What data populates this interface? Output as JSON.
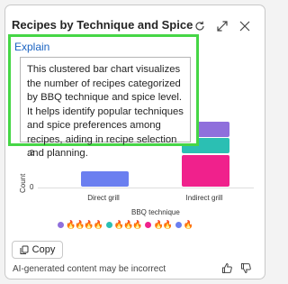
{
  "card": {
    "title": "Recipes by Technique and Spice",
    "refresh_icon": "refresh-icon",
    "expand_icon": "expand-icon",
    "close_icon": "close-icon"
  },
  "explain": {
    "link": "Explain",
    "text": "This clustered bar chart visualizes the number of recipes categorized by BBQ technique and spice level. It helps identify popular techniques and spice preferences among recipes, aiding in recipe selection and planning."
  },
  "chart_data": {
    "type": "bar",
    "stacked": true,
    "categories": [
      "Direct grill",
      "Indirect grill"
    ],
    "xlabel": "BBQ technique",
    "ylabel": "Count",
    "yticks": [
      "0",
      "2"
    ],
    "series": [
      {
        "name": "🔥🔥🔥🔥",
        "color": "#8f6fdc",
        "values": [
          0,
          1
        ]
      },
      {
        "name": "🔥🔥🔥",
        "color": "#2bbfb3",
        "values": [
          0,
          1
        ]
      },
      {
        "name": "🔥🔥",
        "color": "#f0218c",
        "values": [
          0,
          2
        ]
      },
      {
        "name": "🔥",
        "color": "#6b7ff0",
        "values": [
          1,
          0
        ]
      }
    ]
  },
  "footer": {
    "copy_label": "Copy",
    "disclaimer": "AI-generated content may be incorrect"
  }
}
